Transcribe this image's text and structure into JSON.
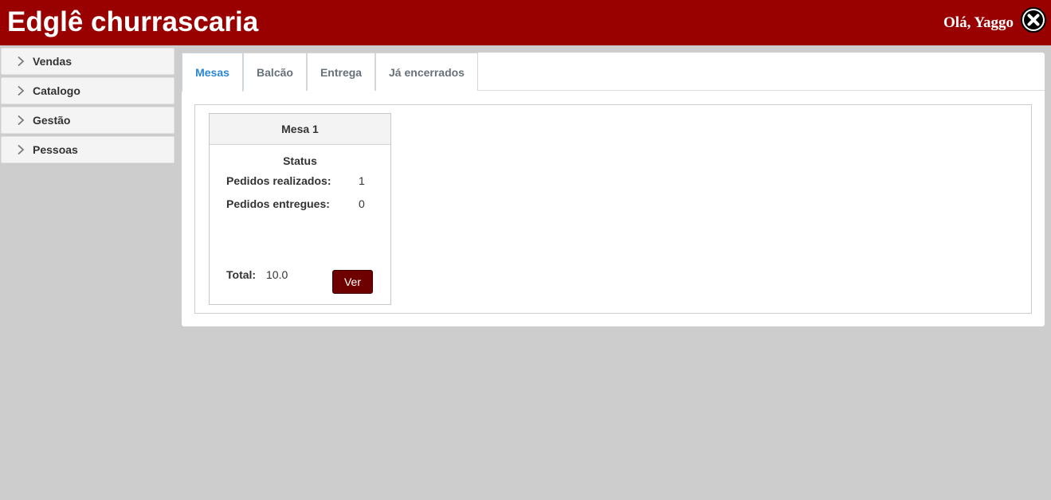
{
  "header": {
    "title": "Edglê churrascaria",
    "greeting": "Olá, Yaggo",
    "close_icon": "close-circle-icon",
    "background": "#990000"
  },
  "sidebar": {
    "items": [
      {
        "label": "Vendas",
        "icon": "chevron-right-icon"
      },
      {
        "label": "Catalogo",
        "icon": "chevron-right-icon"
      },
      {
        "label": "Gestão",
        "icon": "chevron-right-icon"
      },
      {
        "label": "Pessoas",
        "icon": "chevron-right-icon"
      }
    ]
  },
  "tabs": [
    {
      "label": "Mesas",
      "active": true
    },
    {
      "label": "Balcão",
      "active": false
    },
    {
      "label": "Entrega",
      "active": false
    },
    {
      "label": "Já encerrados",
      "active": false
    }
  ],
  "mesa_card": {
    "title": "Mesa 1",
    "status_title": "Status",
    "pedidos_realizados_label": "Pedidos realizados:",
    "pedidos_realizados_value": "1",
    "pedidos_entregues_label": "Pedidos entregues:",
    "pedidos_entregues_value": "0",
    "total_label": "Total:",
    "total_value": "10.0",
    "ver_button": "Ver",
    "button_color": "#6f0000"
  }
}
